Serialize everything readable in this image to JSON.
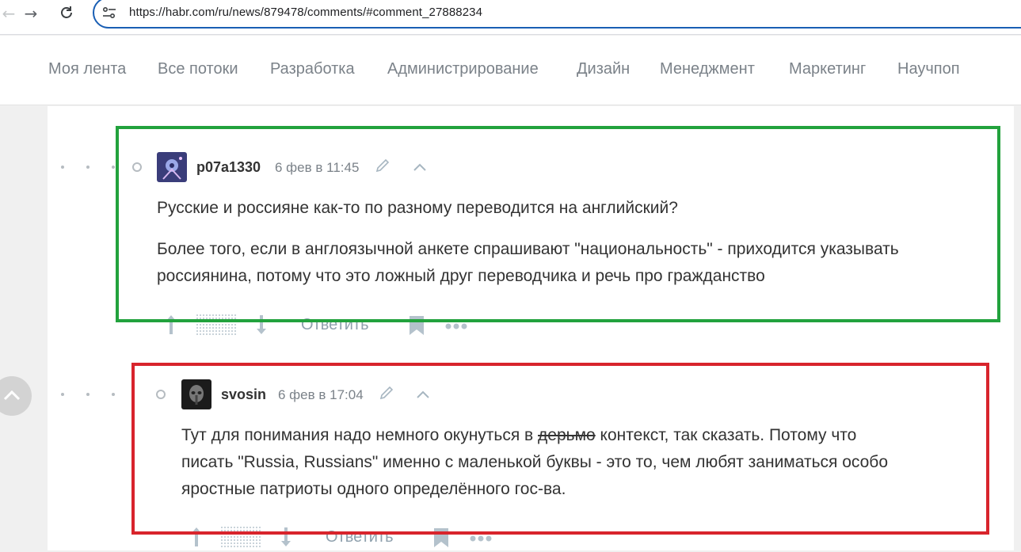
{
  "browser": {
    "url": "https://habr.com/ru/news/879478/comments/#comment_27888234"
  },
  "site_nav": {
    "items": [
      {
        "label": "Моя лента"
      },
      {
        "label": "Все потоки"
      },
      {
        "label": "Разработка"
      },
      {
        "label": "Администрирование"
      },
      {
        "label": "Дизайн"
      },
      {
        "label": "Менеджмент"
      },
      {
        "label": "Маркетинг"
      },
      {
        "label": "Научпоп"
      }
    ]
  },
  "comments": [
    {
      "username": "p07a1330",
      "date": "6 фев в 11:45",
      "paragraphs": [
        "Русские и россияне как-то по разному переводится на английский?",
        "Более того, если в англоязычной анкете спрашивают \"национальность\" - приходится указывать",
        "россиянина, потому что это ложный друг переводчика и речь про гражданство"
      ],
      "reply_label": "Ответить",
      "highlight_color": "#22a23d"
    },
    {
      "username": "svosin",
      "date": "6 фев в 17:04",
      "line1_before": "Тут для понимания надо немного окунуться в ",
      "line1_struck": "дерьмо",
      "line1_after": " контекст, так сказать. Потому что",
      "line2": "писать \"Russia, Russians\" именно с маленькой буквы - это то, чем любят заниматься особо",
      "line3": "яростные патриоты одного определённого гос-ва.",
      "reply_label": "Ответить",
      "highlight_color": "#d8242c"
    }
  ],
  "icons": {
    "back": "arrow-left-icon",
    "forward": "arrow-right-icon",
    "reload": "reload-icon",
    "site_info": "tune-icon",
    "edit": "pencil-icon",
    "collapse": "chevron-up-icon",
    "upvote": "arrow-up-icon",
    "downvote": "arrow-down-icon",
    "bookmark": "bookmark-icon",
    "more": "more-dots-icon",
    "scroll_top": "chevron-up-icon"
  }
}
